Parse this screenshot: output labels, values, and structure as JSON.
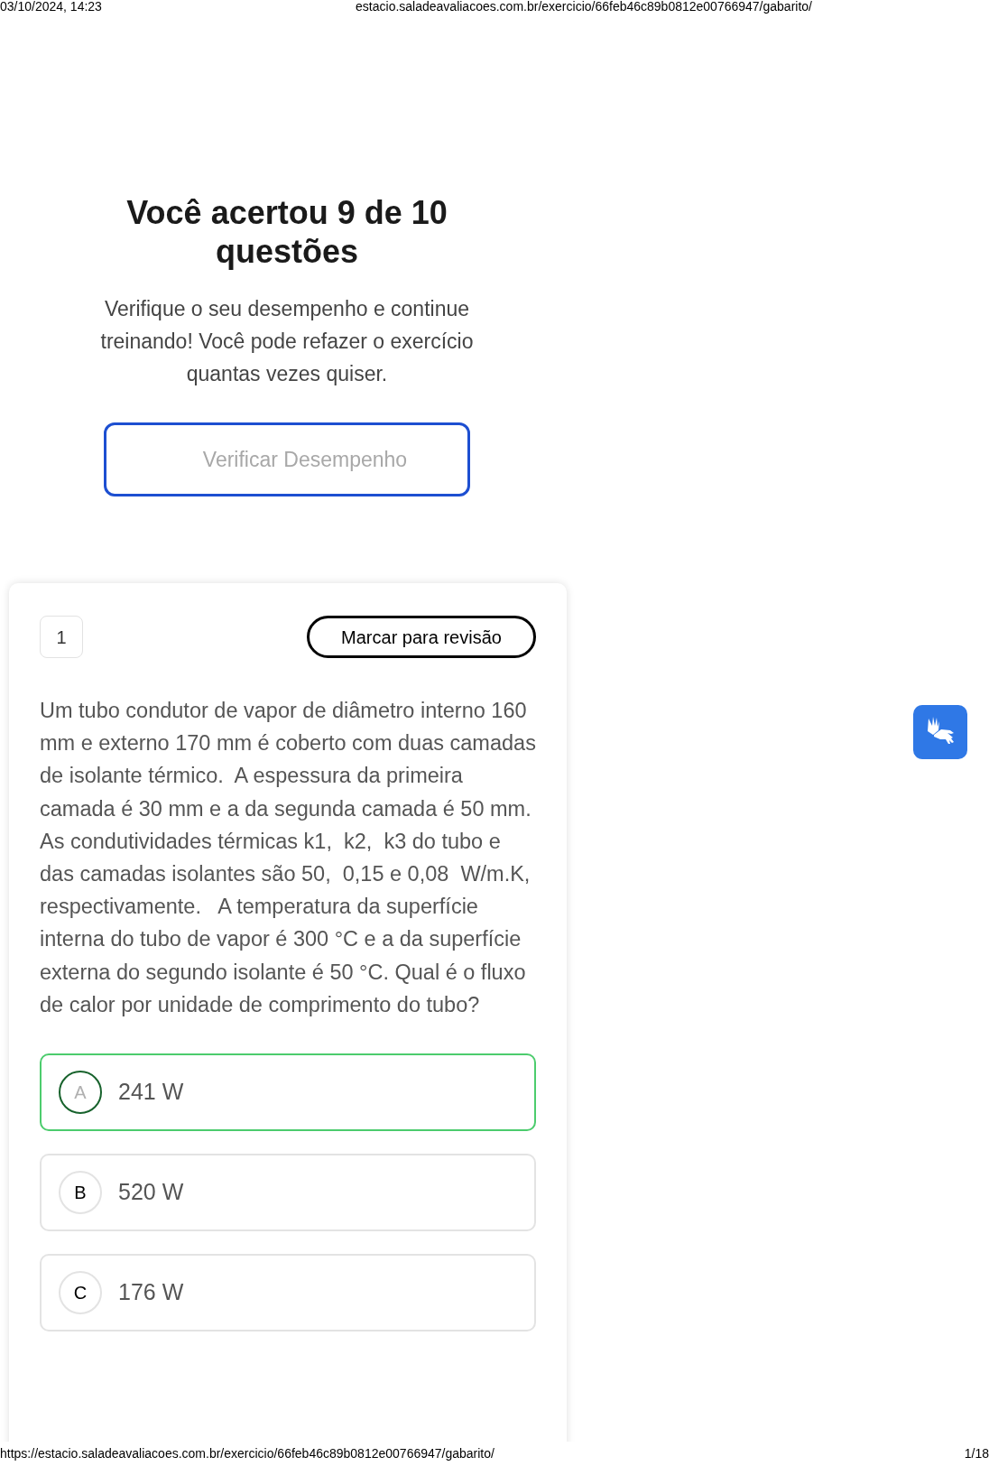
{
  "print_header": {
    "date": "03/10/2024, 14:23",
    "url": "estacio.saladeavaliacoes.com.br/exercicio/66feb46c89b0812e00766947/gabarito/"
  },
  "result": {
    "title": "Você acertou 9 de 10 questões",
    "message": "Verifique o seu desempenho e continue treinando! Você pode refazer o exercício quantas vezes quiser.",
    "button": "Verificar Desempenho"
  },
  "question": {
    "number": "1",
    "review_button": "Marcar para revisão",
    "text": "Um tubo condutor de vapor de diâmetro interno 160 mm e externo 170 mm é coberto com duas camadas de isolante térmico.  A espessura da primeira camada é 30 mm e a da segunda camada é 50 mm.   As condutividades térmicas k1,  k2,  k3 do tubo e das camadas isolantes são 50,  0,15 e 0,08  W/m.K, respectivamente.   A temperatura da superfície interna do tubo de vapor é 300 °C e a da superfície externa do segundo isolante é 50 °C. Qual é o fluxo de calor por unidade de comprimento do tubo?",
    "options": [
      {
        "letter": "A",
        "text": "241 W",
        "selected": true
      },
      {
        "letter": "B",
        "text": "520 W",
        "selected": false
      },
      {
        "letter": "C",
        "text": "176 W",
        "selected": false
      }
    ]
  },
  "print_footer": {
    "url": "https://estacio.saladeavaliacoes.com.br/exercicio/66feb46c89b0812e00766947/gabarito/",
    "page": "1/18"
  }
}
